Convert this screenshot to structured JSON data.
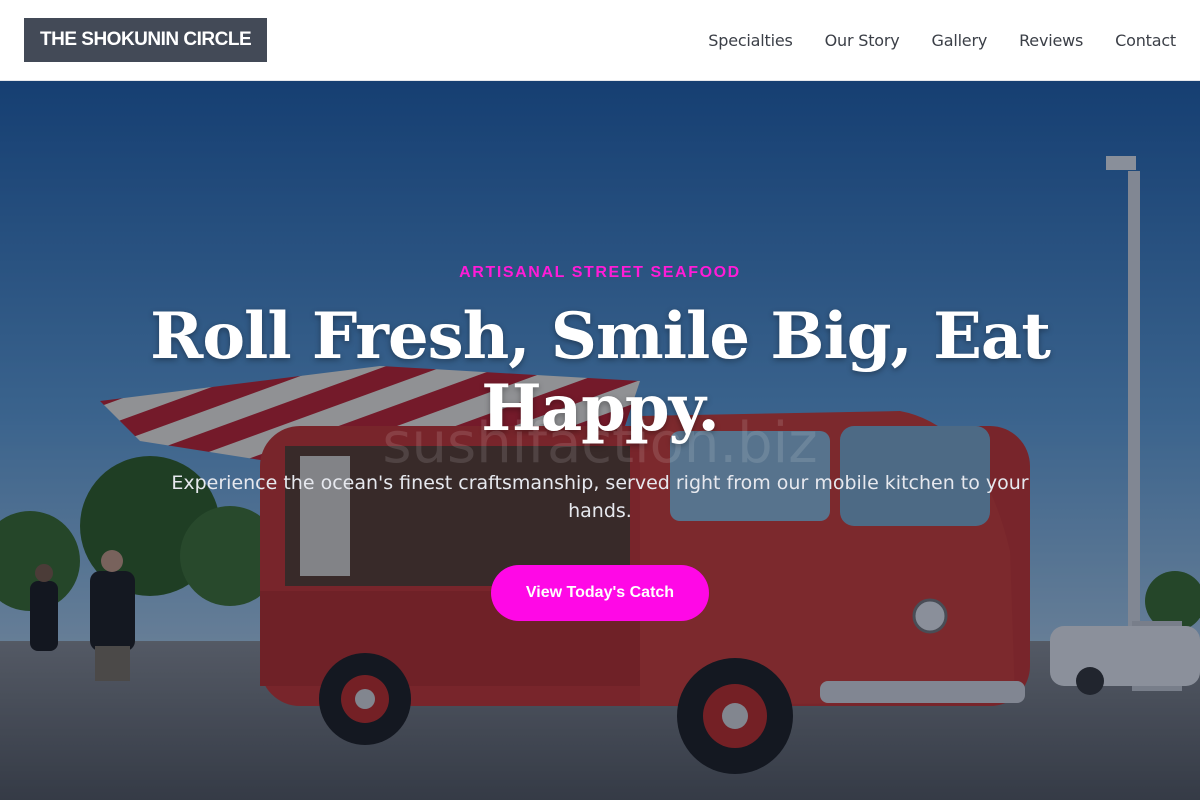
{
  "header": {
    "logo": "THE SHOKUNIN CIRCLE",
    "nav": [
      "Specialties",
      "Our Story",
      "Gallery",
      "Reviews",
      "Contact"
    ]
  },
  "hero": {
    "eyebrow": "ARTISANAL STREET SEAFOOD",
    "headline": "Roll Fresh, Smile Big, Eat Happy.",
    "subtitle": "Experience the ocean's finest craftsmanship, served right from our mobile kitchen to your hands.",
    "watermark": "sushifaction.biz",
    "cta": "View Today's Catch",
    "background": "red food truck with striped awning parked in a lot under blue sky"
  },
  "colors": {
    "accent": "#ff08e6",
    "eyebrow": "#ff1bd7",
    "logo_bg": "#434a57",
    "nav_text": "#3b3f47"
  }
}
